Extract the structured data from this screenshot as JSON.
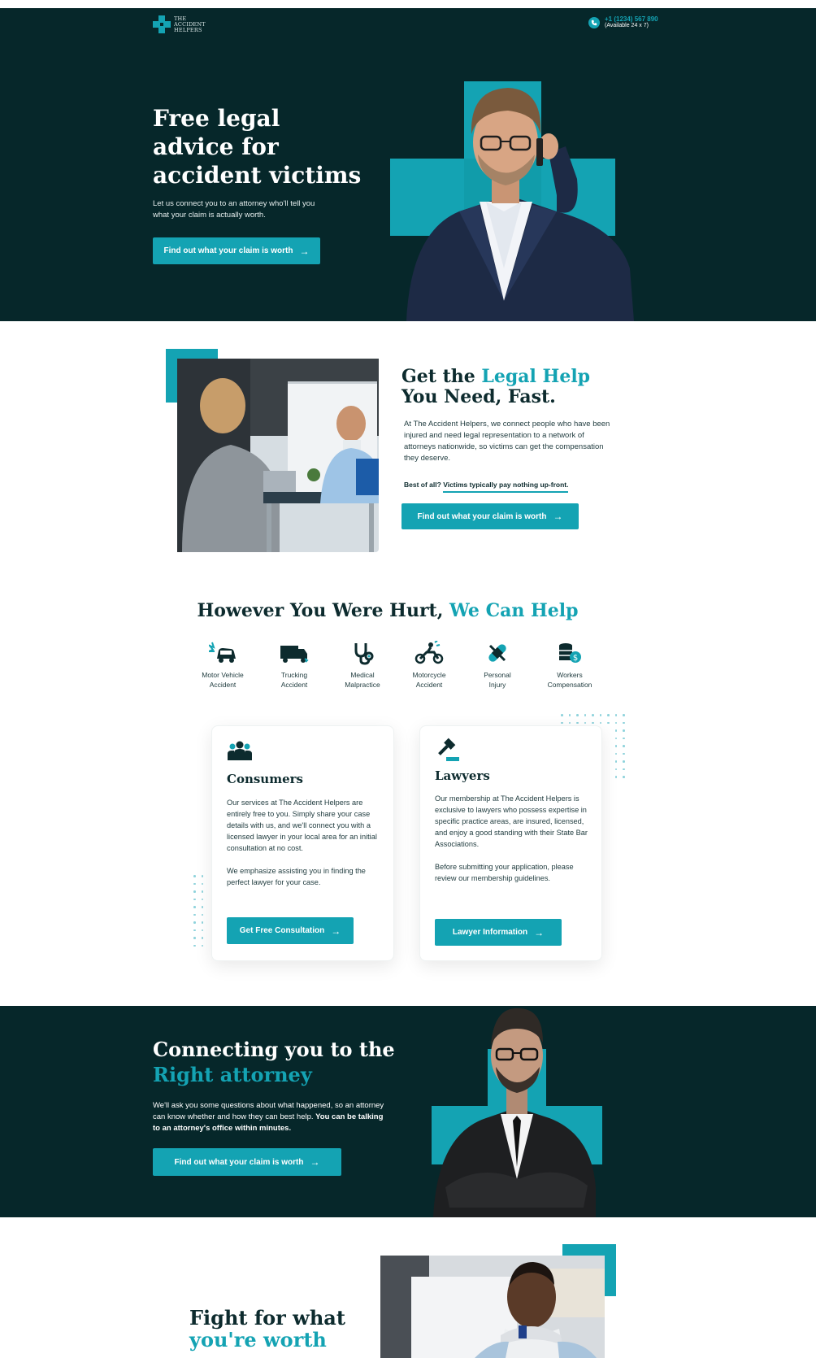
{
  "header": {
    "logo_line1": "THE",
    "logo_line2": "ACCIDENT",
    "logo_line3": "HELPERS",
    "phone": "+1 (1234) 567 890",
    "phone_sub": "(Available 24 x 7)"
  },
  "hero": {
    "title": "Free legal advice for accident victims",
    "subtitle": "Let us connect you to an attorney who'll tell you what your claim is actually worth.",
    "cta": "Find out what your claim is worth"
  },
  "help": {
    "title_prefix": "Get the ",
    "title_highlight": "Legal Help",
    "title_suffix": "You Need, Fast.",
    "body": "At The Accident Helpers, we connect people who have been injured and need legal representation to a network of attorneys nationwide, so victims can get the compensation they deserve.",
    "note_prefix": "Best of all? ",
    "note_highlight": "Victims typically pay nothing up-front.",
    "cta": "Find out what your claim is worth"
  },
  "hurt": {
    "title_prefix": "However You Were Hurt, ",
    "title_highlight": "We Can Help",
    "categories": [
      {
        "line1": "Motor Vehicle",
        "line2": "Accident",
        "icon": "car-crash-icon"
      },
      {
        "line1": "Trucking",
        "line2": "Accident",
        "icon": "truck-icon"
      },
      {
        "line1": "Medical",
        "line2": "Malpractice",
        "icon": "stethoscope-icon"
      },
      {
        "line1": "Motorcycle",
        "line2": "Accident",
        "icon": "motorcycle-icon"
      },
      {
        "line1": "Personal",
        "line2": "Injury",
        "icon": "bandage-icon"
      },
      {
        "line1": "Workers",
        "line2": "Compensation",
        "icon": "coins-icon"
      }
    ]
  },
  "consumers": {
    "title": "Consumers",
    "body1": "Our services at The Accident Helpers are entirely free to you. Simply share your case details with us, and we'll connect you with a licensed lawyer in your local area for an initial consultation at no cost.",
    "body2": "We emphasize assisting you in finding the perfect lawyer for your case.",
    "cta": "Get Free Consultation"
  },
  "lawyers": {
    "title": "Lawyers",
    "body1": "Our membership at The Accident Helpers is exclusive to lawyers who possess expertise in specific practice areas, are insured, licensed, and enjoy a good standing with their State Bar Associations.",
    "body2": "Before submitting your application, please review our membership guidelines.",
    "cta": "Lawyer Information"
  },
  "connect": {
    "title_line1": "Connecting you to the",
    "title_line2": "Right attorney",
    "body": "We'll ask you some questions about what happened, so an attorney can know whether and how they can best help. ",
    "body_bold": "You can be talking to an attorney's office within minutes.",
    "cta": "Find out what your claim is worth"
  },
  "fight": {
    "title_line1": "Fight for what",
    "title_line2": "you're worth"
  },
  "colors": {
    "brand": "#14a3b3",
    "dark": "#06272a"
  }
}
